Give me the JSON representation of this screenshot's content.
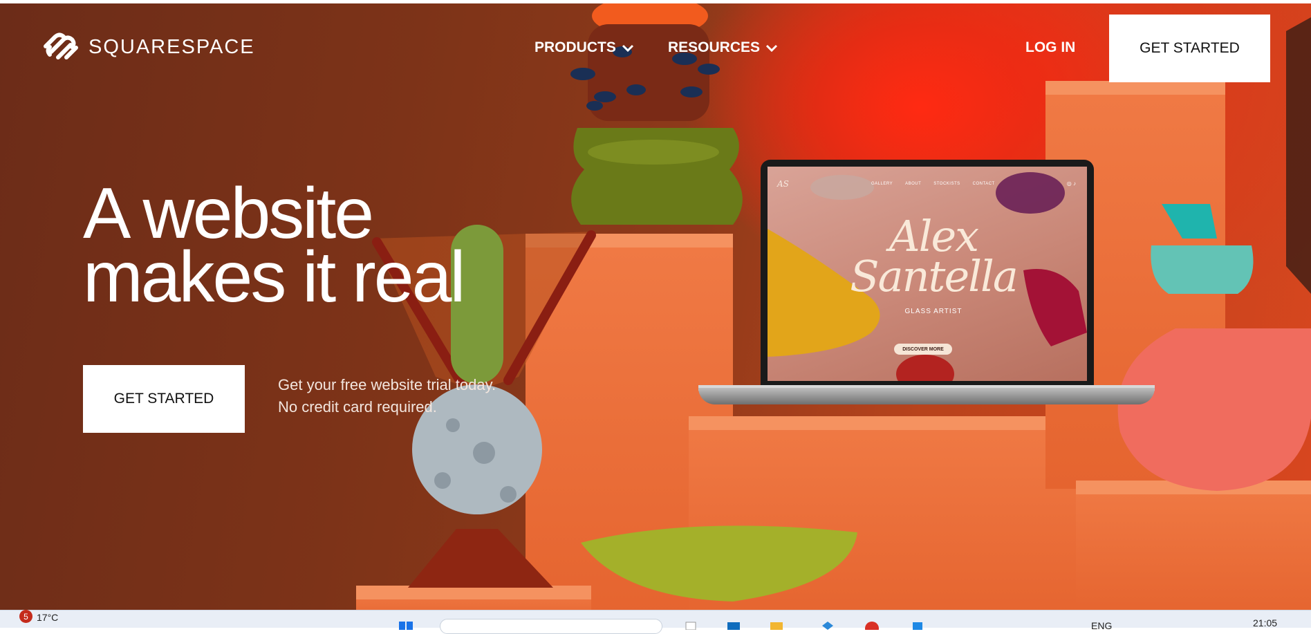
{
  "brand": {
    "name": "SQUARESPACE",
    "logo_icon": "squarespace-logo-icon"
  },
  "nav": {
    "items": [
      {
        "label": "PRODUCTS",
        "icon": "chevron-down-icon"
      },
      {
        "label": "RESOURCES",
        "icon": "chevron-down-icon"
      }
    ],
    "login_label": "LOG IN",
    "cta_label": "GET STARTED"
  },
  "hero": {
    "headline_line1": "A website",
    "headline_line2": "makes it real",
    "cta_label": "GET STARTED",
    "trial_line1": "Get your free website trial today.",
    "trial_line2": "No credit card required."
  },
  "laptop_site": {
    "logo": "AS",
    "nav": [
      "GALLERY",
      "ABOUT",
      "STOCKISTS",
      "CONTACT"
    ],
    "name_line1": "Alex",
    "name_line2": "Santella",
    "subtitle": "GLASS ARTIST",
    "button": "DISCOVER MORE"
  },
  "taskbar": {
    "notification_count": "5",
    "temperature": "17°C",
    "language": "ENG",
    "time": "21:05"
  },
  "colors": {
    "background_dark": "#6c2c18",
    "accent_red": "#ff2a12",
    "block_orange": "#f07a45",
    "white": "#ffffff"
  }
}
